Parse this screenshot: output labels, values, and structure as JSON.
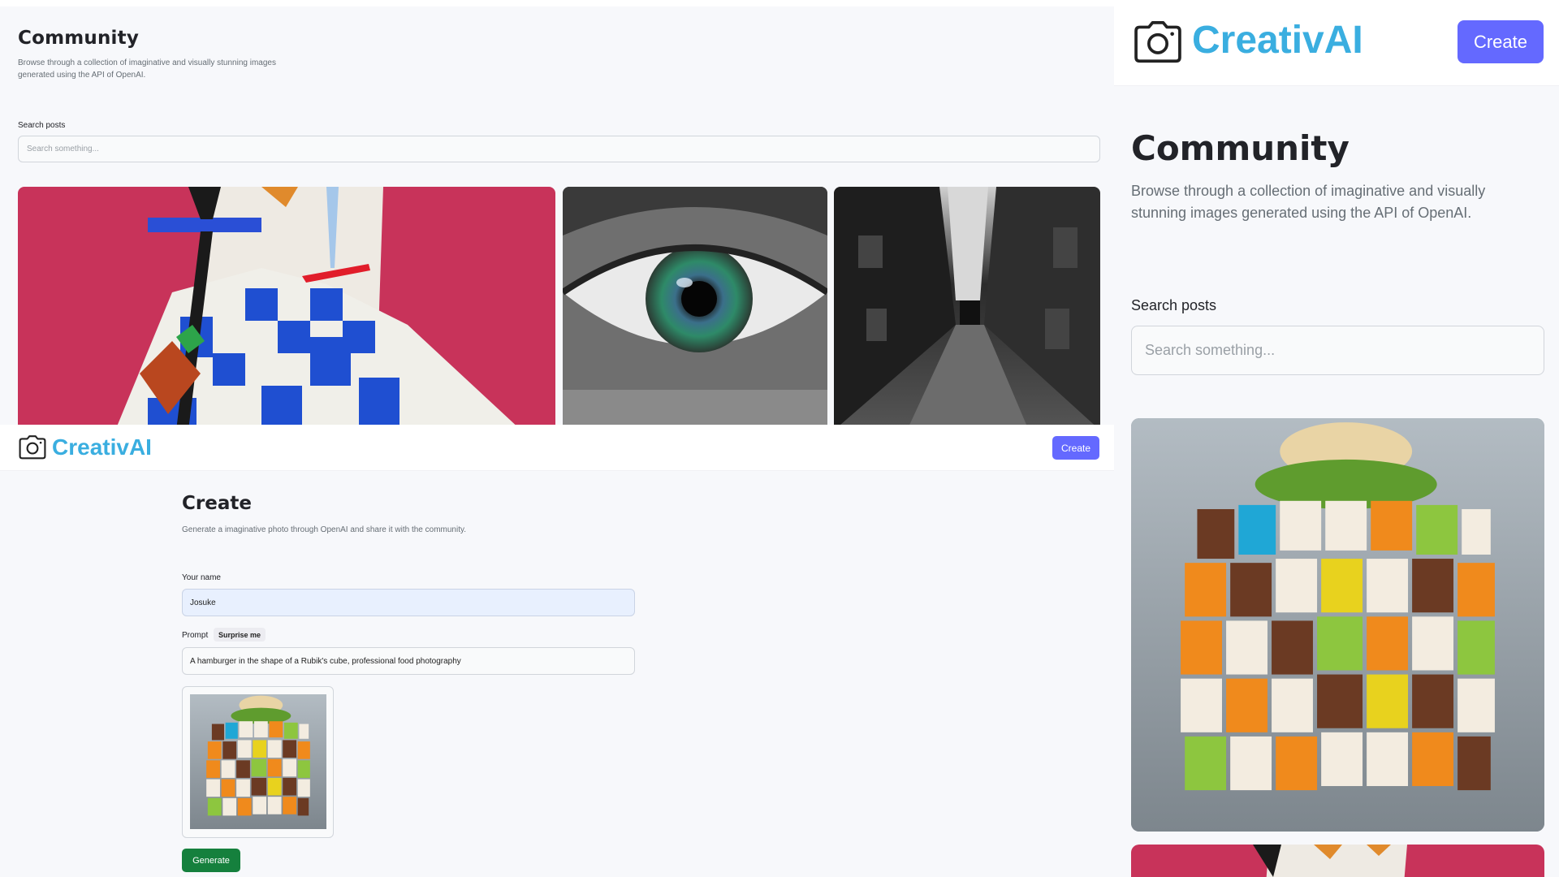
{
  "brand": {
    "name": "CreativAI",
    "color": "#3aaee0"
  },
  "header": {
    "create_label": "Create"
  },
  "community": {
    "title": "Community",
    "subtitle": "Browse through a collection of imaginative and visually stunning images generated using the API of OpenAI.",
    "search_label": "Search posts",
    "search_placeholder": "Search something..."
  },
  "gallery": {
    "images": [
      {
        "name": "cubist-portrait-image"
      },
      {
        "name": "eye-closeup-image"
      },
      {
        "name": "alley-image"
      }
    ]
  },
  "create_page": {
    "title": "Create",
    "subtitle": "Generate a imaginative photo through OpenAI and share it with the community.",
    "name_label": "Your name",
    "name_value": "Josuke",
    "prompt_label": "Prompt",
    "surprise_label": "Surprise me",
    "prompt_value": "A hamburger in the shape of a Rubik's cube, professional food photography",
    "generate_label": "Generate"
  },
  "colors": {
    "accent": "#6469ff",
    "generate": "#15803d",
    "page_bg": "#f7f8fb"
  },
  "icons": {
    "logo": "camera-icon"
  }
}
